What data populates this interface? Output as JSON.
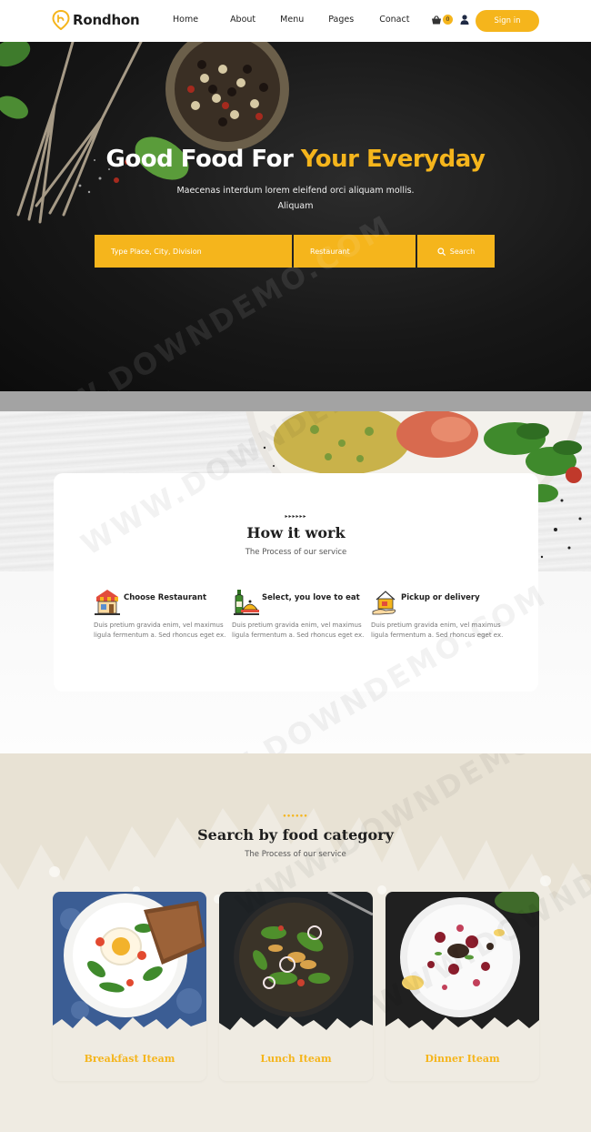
{
  "brand": {
    "name": "Rondhon",
    "accent": "#f5b51c"
  },
  "nav": {
    "links": [
      "Home",
      "About",
      "Menu",
      "Pages",
      "Conact"
    ],
    "cart_count": "0",
    "signin_label": "Sign in"
  },
  "hero": {
    "title_white": "Good Food For",
    "title_accent": "Your Everyday",
    "subtitle": "Maecenas interdum lorem eleifend orci aliquam mollis. Aliquam",
    "location_placeholder": "Type Place, City, Division",
    "restaurant_placeholder": "Restaurant",
    "search_label": "Search"
  },
  "how": {
    "title": "How it work",
    "subtitle": "The Process of our service",
    "steps": [
      {
        "icon": "restaurant-store-icon",
        "title": "Choose Restaurant",
        "text": "Duis pretium gravida enim, vel maximus ligula fermentum a. Sed rhoncus eget ex."
      },
      {
        "icon": "wine-bottle-food-icon",
        "title": "Select, you love to eat",
        "text": "Duis pretium gravida enim, vel maximus ligula fermentum a. Sed rhoncus eget ex."
      },
      {
        "icon": "delivery-house-icon",
        "title": "Pickup or delivery",
        "text": "Duis pretium gravida enim, vel maximus ligula fermentum a. Sed rhoncus eget ex."
      }
    ]
  },
  "categories": {
    "title": "Search by food category",
    "subtitle": "The Process of our service",
    "items": [
      {
        "name": "Breakfast Iteam"
      },
      {
        "name": "Lunch Iteam"
      },
      {
        "name": "Dinner Iteam"
      }
    ]
  },
  "watermark": "WWW.DOWNDEMO.COM"
}
